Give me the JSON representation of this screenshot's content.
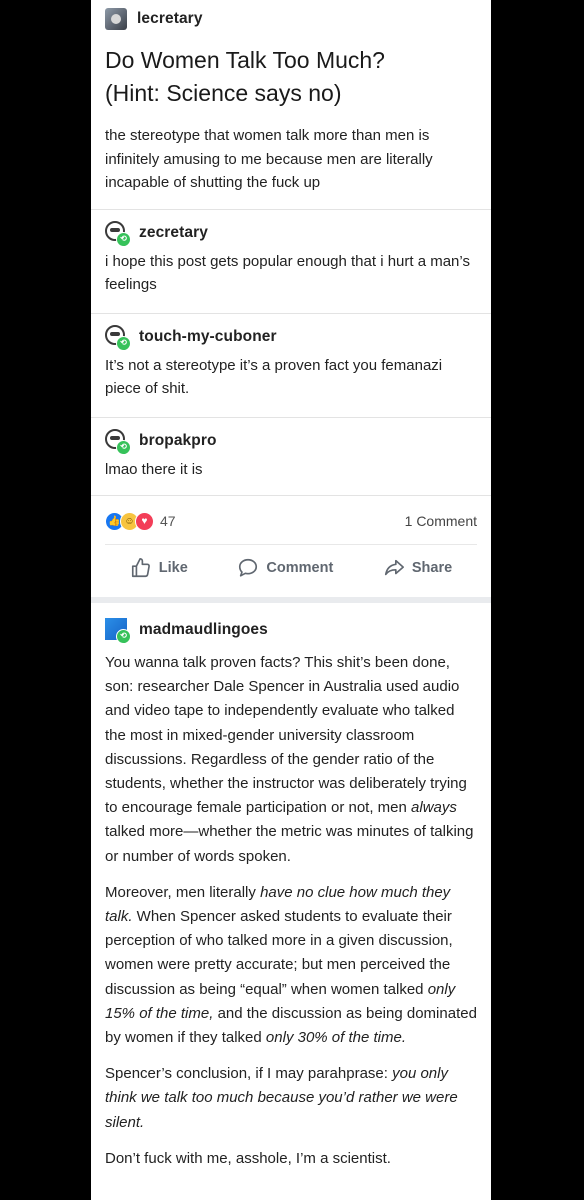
{
  "post": {
    "username": "lecretary",
    "title_line1": "Do Women Talk Too Much?",
    "title_line2": "(Hint: Science says no)",
    "body": "the stereotype that women talk more than men is infinitely amusing to me because men are literally incapable of shutting the fuck up"
  },
  "reblogs": [
    {
      "username": "zecretary",
      "text": "i hope this post gets popular enough that i hurt a man’s feelings"
    },
    {
      "username": "touch-my-cuboner",
      "text": "It’s not a stereotype it’s a proven fact you femanazi piece of shit."
    },
    {
      "username": "bropakpro",
      "text": "lmao there it is"
    }
  ],
  "reactions": {
    "count": "47",
    "comments": "1 Comment",
    "icons": [
      "like-icon",
      "haha-icon",
      "love-icon"
    ]
  },
  "actions": {
    "like": "Like",
    "comment": "Comment",
    "share": "Share"
  },
  "final_reblog": {
    "username": "madmaudlingoes",
    "p1_a": "You wanna talk proven facts? This shit’s been done, son: researcher Dale Spencer in Australia used audio and video tape to independently evaluate who talked the most in mixed-gender university classroom discussions. Regardless of the gender ratio of the students, whether the instructor was deliberately trying to encourage female participation or not, men ",
    "p1_em": "always",
    "p1_b": " talked more—whether the metric was minutes of talking or number of words spoken.",
    "p2_a": "Moreover, men literally ",
    "p2_em1": "have no clue how much they talk.",
    "p2_b": " When Spencer asked students to evaluate their perception of who talked more in a given discussion, women were pretty accurate; but men perceived the discussion as being “equal” when women talked ",
    "p2_em2": "only 15% of the time,",
    "p2_c": " and the discussion as being dominated by women if they talked ",
    "p2_em3": "only 30% of the time.",
    "p3_a": "Spencer’s conclusion, if I may parahprase: ",
    "p3_em": "you only think we talk too much because you’d rather we were silent.",
    "p4": "Don’t fuck with me, asshole, I’m a scientist."
  },
  "colors": {
    "background": "#000000",
    "card": "#ffffff",
    "reblog_badge": "#36c25a",
    "like_blue": "#1877f2",
    "love_red": "#f33e58",
    "haha_yellow": "#f7c440"
  }
}
